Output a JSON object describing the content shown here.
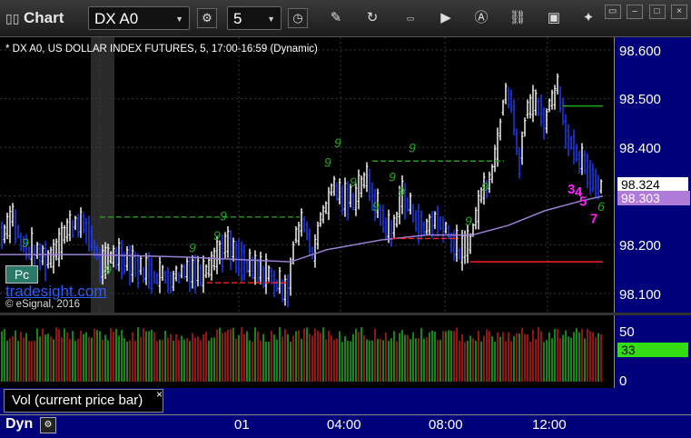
{
  "window": {
    "title": "Chart"
  },
  "toolbar": {
    "symbol": "DX A0",
    "interval": "5"
  },
  "chart": {
    "label": "* DX A0, US DOLLAR INDEX FUTURES, 5, 17:00-16:59 (Dynamic)",
    "copyright": "© eSignal, 2016",
    "watermark": "tradesight.com",
    "pc_badge": "Pc",
    "price_ticks": [
      "98.600",
      "98.500",
      "98.400",
      "98.300",
      "98.200",
      "98.100"
    ],
    "last_price": "98.324",
    "ma_price": "98.303",
    "annotations": [
      "9",
      "9",
      "9",
      "9",
      "9",
      "9",
      "9",
      "9",
      "9",
      "9",
      "9",
      "9",
      "9",
      "9",
      "3",
      "4",
      "5",
      "6",
      "7"
    ],
    "colors": {
      "up_bar": "#ffffff",
      "down_bar": "#1f3cff",
      "ma_line": "#9b7fd4",
      "resistance": "#22aa22",
      "support": "#ff2222",
      "magenta": "#ff22ff"
    }
  },
  "volume": {
    "panel_label": "Vol (current price bar)",
    "ticks": [
      "50",
      "0"
    ],
    "current_value": "33"
  },
  "time_axis": {
    "mode": "Dyn",
    "labels": [
      "01",
      "04:00",
      "08:00",
      "12:00"
    ]
  }
}
